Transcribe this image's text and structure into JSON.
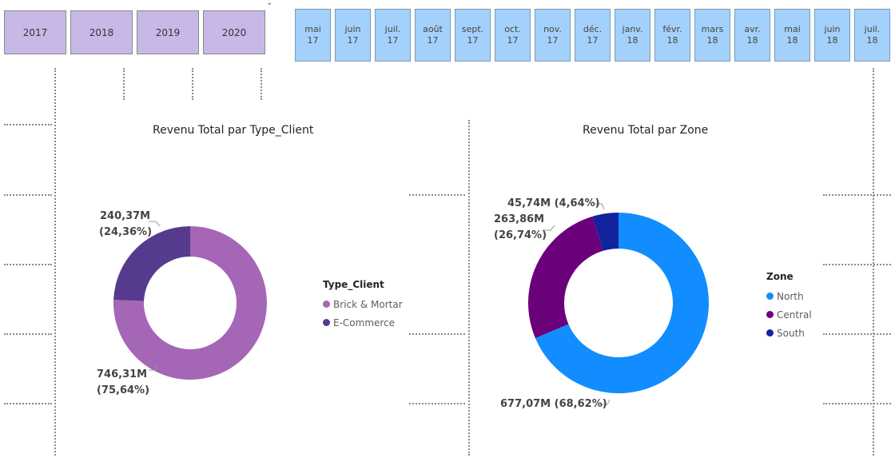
{
  "colors": {
    "year_bg": "#c8b8e8",
    "month_bg": "#a3d1fb",
    "brick_mortar": "#a566b6",
    "ecommerce": "#563a8e",
    "north": "#118dff",
    "central": "#6b007b",
    "south": "#12239e"
  },
  "year_slicer": {
    "items": [
      "2017",
      "2018",
      "2019",
      "2020"
    ]
  },
  "month_slicer": {
    "items": [
      {
        "month": "mai",
        "year": "17"
      },
      {
        "month": "juin",
        "year": "17"
      },
      {
        "month": "juil.",
        "year": "17"
      },
      {
        "month": "août",
        "year": "17"
      },
      {
        "month": "sept.",
        "year": "17"
      },
      {
        "month": "oct.",
        "year": "17"
      },
      {
        "month": "nov.",
        "year": "17"
      },
      {
        "month": "déc.",
        "year": "17"
      },
      {
        "month": "janv.",
        "year": "18"
      },
      {
        "month": "févr.",
        "year": "18"
      },
      {
        "month": "mars",
        "year": "18"
      },
      {
        "month": "avr.",
        "year": "18"
      },
      {
        "month": "mai",
        "year": "18"
      },
      {
        "month": "juin",
        "year": "18"
      },
      {
        "month": "juil.",
        "year": "18"
      }
    ]
  },
  "chart_data": [
    {
      "type": "pie",
      "title": "Revenu Total par Type_Client",
      "legend_title": "Type_Client",
      "legend_position": "right",
      "slices": [
        {
          "name": "Brick & Mortar",
          "value": 746.31,
          "percent": 75.64,
          "label_value": "746,31M",
          "label_pct": "(75,64%)"
        },
        {
          "name": "E-Commerce",
          "value": 240.37,
          "percent": 24.36,
          "label_value": "240,37M",
          "label_pct": "(24,36%)"
        }
      ]
    },
    {
      "type": "pie",
      "title": "Revenu Total par Zone",
      "legend_title": "Zone",
      "legend_position": "right",
      "slices": [
        {
          "name": "North",
          "value": 677.07,
          "percent": 68.62,
          "label_value": "677,07M",
          "label_pct": "(68,62%)"
        },
        {
          "name": "Central",
          "value": 263.86,
          "percent": 26.74,
          "label_value": "263,86M",
          "label_pct": "(26,74%)"
        },
        {
          "name": "South",
          "value": 45.74,
          "percent": 4.64,
          "label_value": "45,74M",
          "label_pct": "(4,64%)"
        }
      ]
    }
  ]
}
